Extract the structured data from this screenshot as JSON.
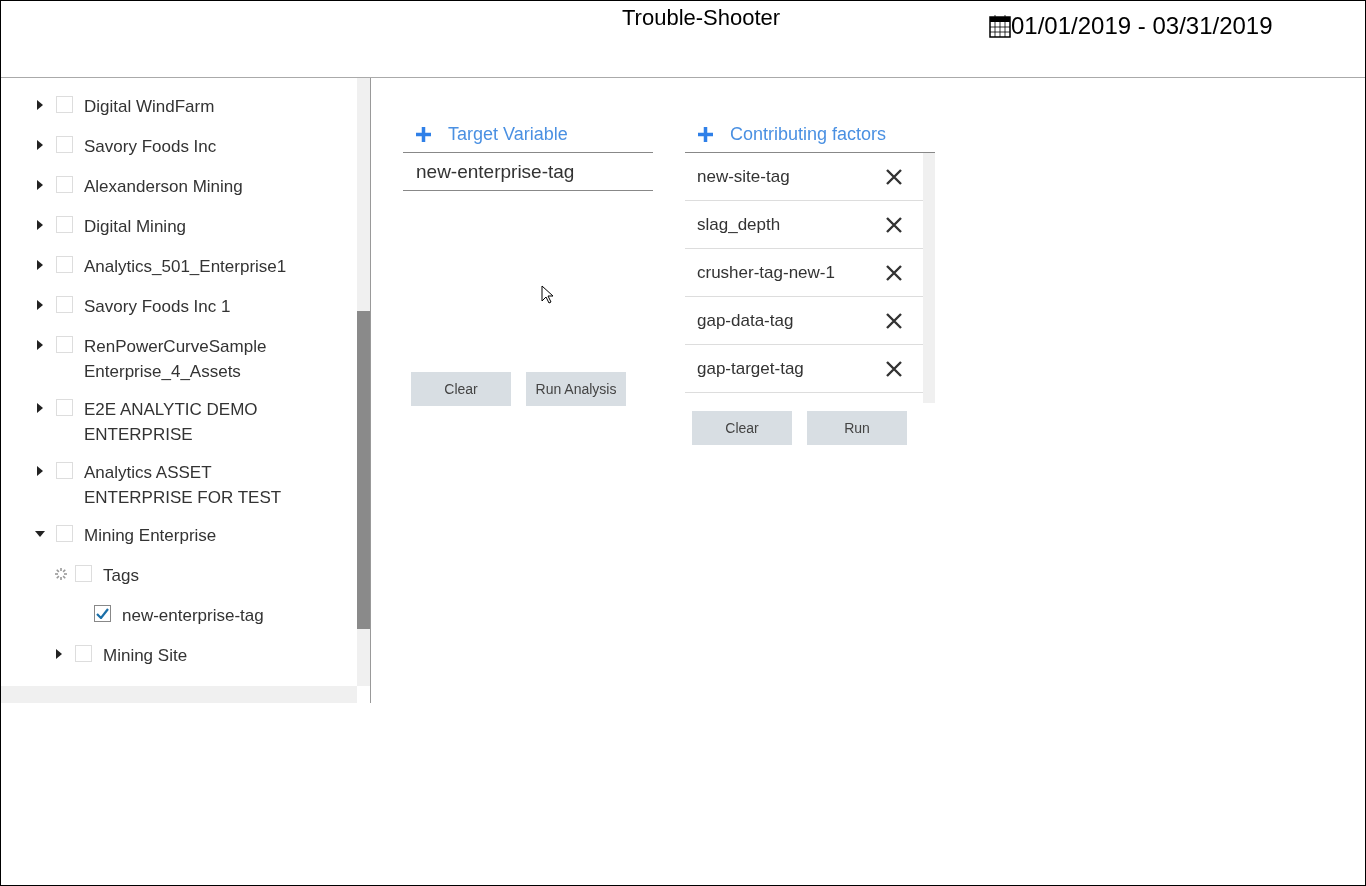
{
  "header": {
    "title": "Trouble-Shooter",
    "date_range": "01/01/2019 - 03/31/2019"
  },
  "tree": [
    {
      "kind": "branch",
      "label": "Digital WindFarm",
      "expanded": false,
      "checked": false
    },
    {
      "kind": "branch",
      "label": "Savory Foods Inc",
      "expanded": false,
      "checked": false
    },
    {
      "kind": "branch",
      "label": "Alexanderson Mining",
      "expanded": false,
      "checked": false
    },
    {
      "kind": "branch",
      "label": "Digital Mining",
      "expanded": false,
      "checked": false
    },
    {
      "kind": "branch",
      "label": "Analytics_501_Enterprise1",
      "expanded": false,
      "checked": false
    },
    {
      "kind": "branch",
      "label": "Savory Foods Inc 1",
      "expanded": false,
      "checked": false
    },
    {
      "kind": "branch",
      "label": "RenPowerCurveSample Enterprise_4_Assets",
      "expanded": false,
      "checked": false
    },
    {
      "kind": "branch",
      "label": "E2E ANALYTIC DEMO ENTERPRISE",
      "expanded": false,
      "checked": false
    },
    {
      "kind": "branch",
      "label": "Analytics ASSET ENTERPRISE FOR TEST",
      "expanded": false,
      "checked": false
    },
    {
      "kind": "branch",
      "label": "Mining Enterprise",
      "expanded": true,
      "checked": false,
      "children": [
        {
          "kind": "loading",
          "label": "Tags",
          "checked": false,
          "children": [
            {
              "kind": "leaf",
              "label": "new-enterprise-tag",
              "checked": true
            }
          ]
        },
        {
          "kind": "branch",
          "label": "Mining Site",
          "expanded": false,
          "checked": false
        }
      ]
    }
  ],
  "target": {
    "heading": "Target Variable",
    "value": "new-enterprise-tag",
    "buttons": [
      "Clear",
      "Run Analysis"
    ]
  },
  "factors": {
    "heading": "Contributing factors",
    "items": [
      "new-site-tag",
      "slag_depth",
      "crusher-tag-new-1",
      "gap-data-tag",
      "gap-target-tag"
    ],
    "buttons": [
      "Clear",
      "Run"
    ]
  }
}
